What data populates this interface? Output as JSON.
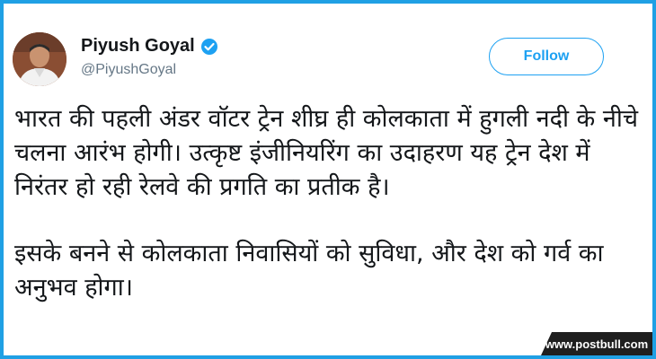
{
  "account": {
    "display_name": "Piyush Goyal",
    "handle": "@PiyushGoyal",
    "verified": true,
    "verified_color": "#1da1f2"
  },
  "actions": {
    "follow_label": "Follow",
    "accent_color": "#1da1f2"
  },
  "tweet": {
    "paragraphs": [
      "भारत की पहली अंडर वॉटर ट्रेन शीघ्र ही कोलकाता में हुगली नदी के नीचे चलना आरंभ होगी। उत्कृष्ट इंजीनियरिंग का उदाहरण यह ट्रेन देश में निरंतर हो रही रेलवे की प्रगति का प्रतीक है।",
      "इसके बनने से कोलकाता निवासियों को सुविधा, और देश को गर्व का अनुभव होगा।"
    ]
  },
  "watermark": {
    "text": "www.postbull.com"
  },
  "frame": {
    "border_color": "#1fa0e4"
  }
}
